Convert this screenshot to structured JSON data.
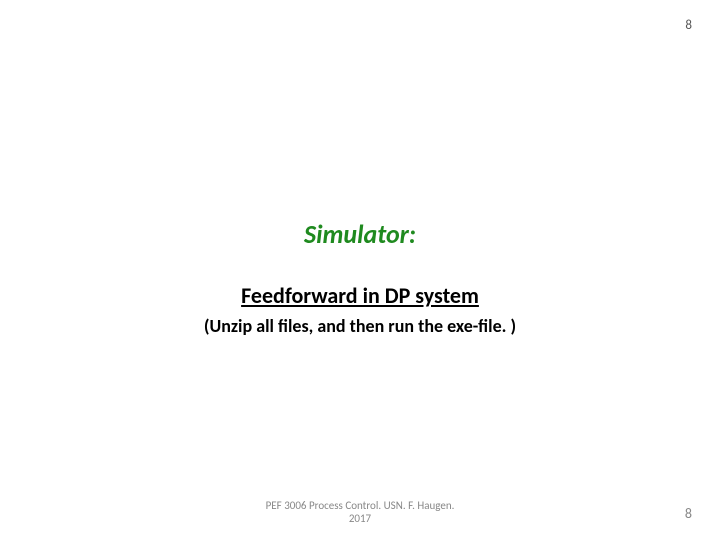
{
  "page_number_top": "8",
  "heading": "Simulator:",
  "link_text": "Feedforward in DP system",
  "instruction": "(Unzip all files, and then run the exe-file. )",
  "footer": {
    "line1": "PEF 3006 Process Control. USN. F. Haugen.",
    "line2": "2017"
  },
  "page_number_bottom": "8"
}
